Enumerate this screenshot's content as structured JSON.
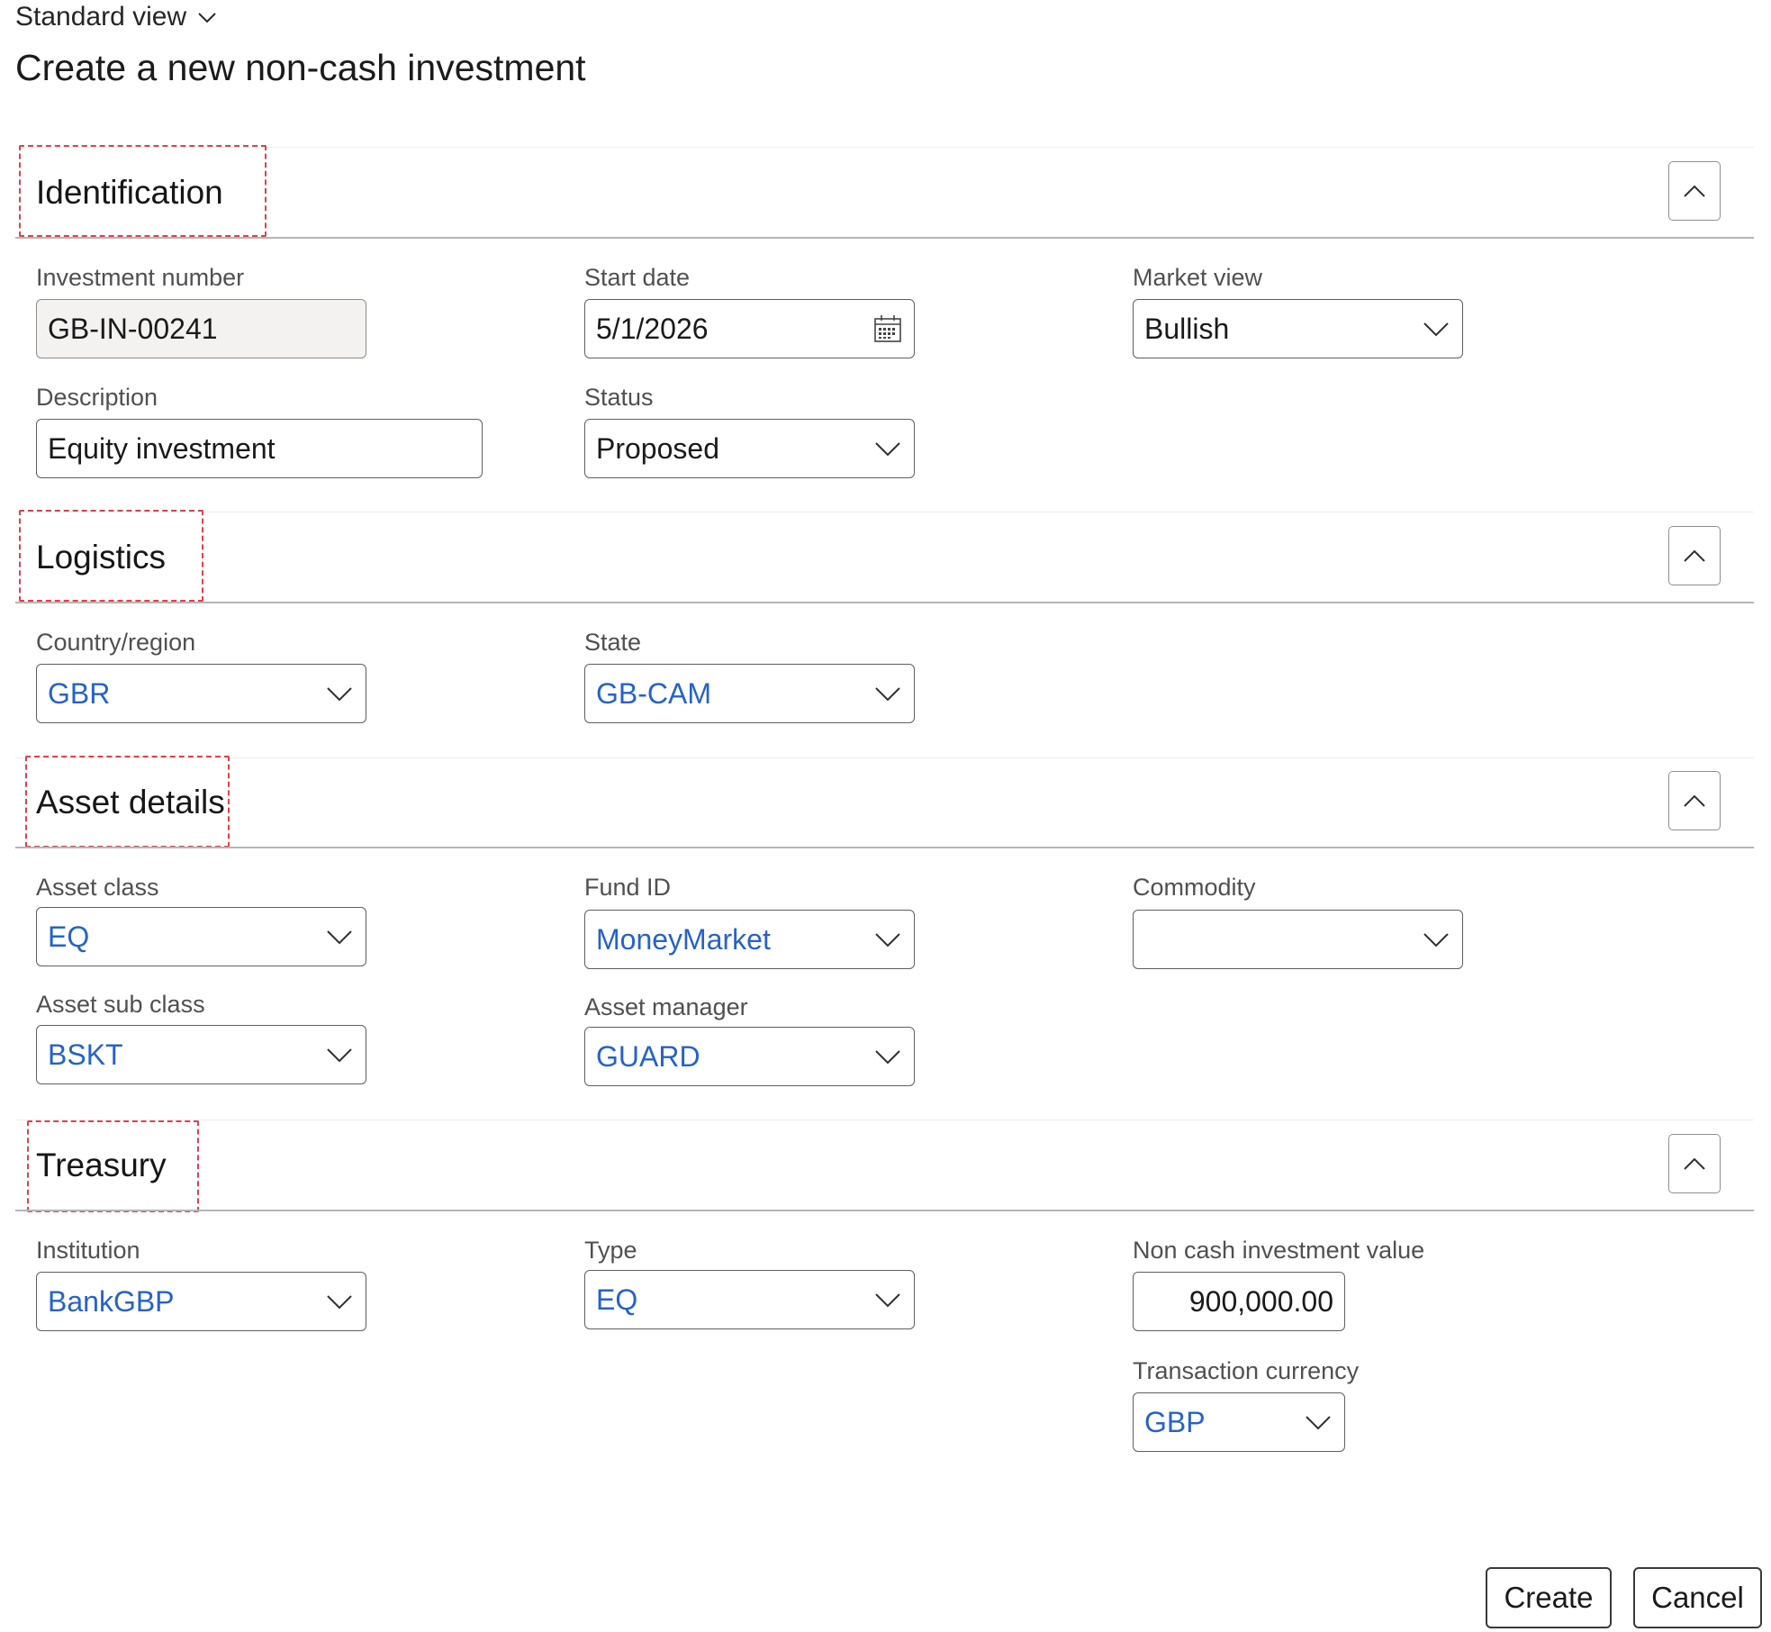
{
  "header": {
    "view_selector": "Standard view",
    "title": "Create a new non-cash investment"
  },
  "sections": {
    "identification": {
      "title": "Identification",
      "investment_number": {
        "label": "Investment number",
        "value": "GB-IN-00241"
      },
      "start_date": {
        "label": "Start date",
        "value": "5/1/2026"
      },
      "market_view": {
        "label": "Market view",
        "value": "Bullish"
      },
      "description": {
        "label": "Description",
        "value": "Equity investment"
      },
      "status": {
        "label": "Status",
        "value": "Proposed"
      }
    },
    "logistics": {
      "title": "Logistics",
      "country_region": {
        "label": "Country/region",
        "value": "GBR"
      },
      "state": {
        "label": "State",
        "value": "GB-CAM"
      }
    },
    "asset_details": {
      "title": "Asset details",
      "asset_class": {
        "label": "Asset class",
        "value": "EQ"
      },
      "fund_id": {
        "label": "Fund ID",
        "value": "MoneyMarket"
      },
      "commodity": {
        "label": "Commodity",
        "value": ""
      },
      "asset_sub_class": {
        "label": "Asset sub class",
        "value": "BSKT"
      },
      "asset_manager": {
        "label": "Asset manager",
        "value": "GUARD"
      }
    },
    "treasury": {
      "title": "Treasury",
      "institution": {
        "label": "Institution",
        "value": "BankGBP"
      },
      "type": {
        "label": "Type",
        "value": "EQ"
      },
      "non_cash_investment_value": {
        "label": "Non cash investment value",
        "value": "900,000.00"
      },
      "transaction_currency": {
        "label": "Transaction currency",
        "value": "GBP"
      }
    }
  },
  "footer": {
    "create_label": "Create",
    "cancel_label": "Cancel"
  },
  "icons": {
    "view_selector": "chevron-down-icon",
    "section_toggle": "chevron-up-icon",
    "dropdown": "chevron-down-icon",
    "date_picker": "calendar-icon"
  },
  "colors": {
    "link_value": "#2563c9",
    "highlight_annotation": "#e0404c",
    "readonly_background": "#f3f2f1"
  }
}
